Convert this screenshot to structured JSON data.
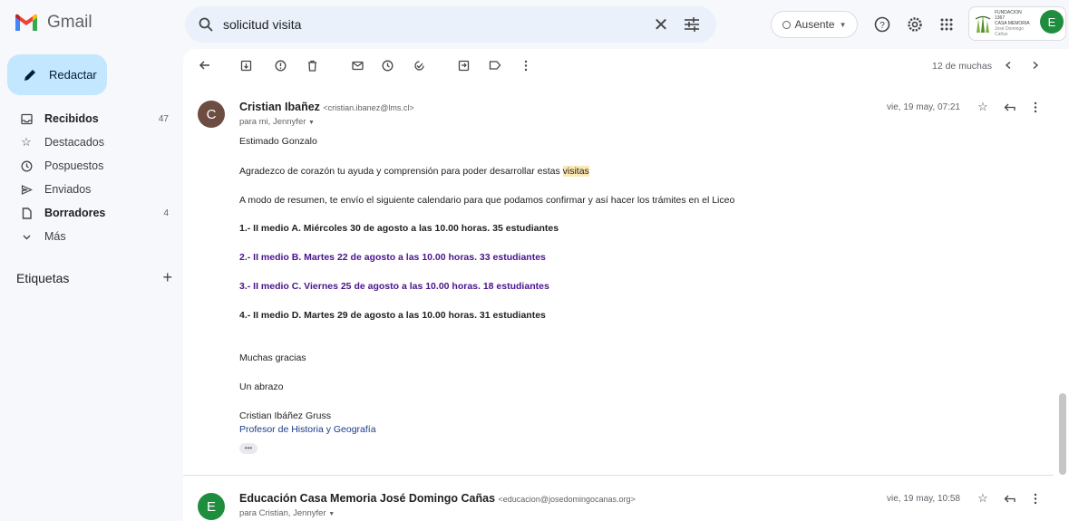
{
  "app": {
    "name": "Gmail"
  },
  "search": {
    "query": "solicitud visita"
  },
  "status": {
    "label": "Ausente"
  },
  "org": {
    "line1": "FUNDACION 1367",
    "line2": "CASA MEMORIA",
    "line3": "José Domingo Cañas"
  },
  "account": {
    "initial": "E"
  },
  "sidebar": {
    "compose_label": "Redactar",
    "items": [
      {
        "label": "Recibidos",
        "count": "47",
        "icon": "inbox-icon"
      },
      {
        "label": "Destacados",
        "count": "",
        "icon": "star-icon"
      },
      {
        "label": "Pospuestos",
        "count": "",
        "icon": "clock-icon"
      },
      {
        "label": "Enviados",
        "count": "",
        "icon": "send-icon"
      },
      {
        "label": "Borradores",
        "count": "4",
        "icon": "draft-icon"
      },
      {
        "label": "Más",
        "count": "",
        "icon": "chevron-down-icon"
      }
    ],
    "labels_title": "Etiquetas"
  },
  "toolbar": {
    "counter": "12 de muchas"
  },
  "message1": {
    "avatar_initial": "C",
    "sender_name": "Cristian Ibañez",
    "sender_email": "<cristian.ibanez@lms.cl>",
    "to": "para mi, Jennyfer",
    "date": "vie, 19 may, 07:21",
    "greeting": "Estimado Gonzalo",
    "para1_before": "Agradezco de corazón tu ayuda y comprensión para poder desarrollar estas ",
    "para1_highlight": "visitas",
    "para2": "A modo de resumen, te envío el siguiente calendario para que podamos confirmar y así hacer los trámites en el Liceo",
    "schedule": [
      "1.- II medio A. Miércoles 30  de agosto a las 10.00 horas. 35 estudiantes",
      "2.- II medio B. Martes 22 de agosto a las 10.00 horas. 33 estudiantes",
      "3.- II medio  C. Viernes 25 de agosto a las 10.00 horas. 18 estudiantes",
      "4.- II medio D. Martes 29  de agosto a las 10.00 horas. 31 estudiantes"
    ],
    "thanks": "Muchas gracias",
    "hug": "Un abrazo",
    "signature_name": "Cristian Ibáñez Gruss",
    "signature_title": "Profesor de Historia y Geografía",
    "ellipsis": "•••"
  },
  "message2": {
    "avatar_initial": "E",
    "sender_name": "Educación Casa Memoria José Domingo Cañas",
    "sender_email": "<educacion@josedomingocanas.org>",
    "to": "para Cristian, Jennyfer",
    "date": "vie, 19 may, 10:58"
  }
}
